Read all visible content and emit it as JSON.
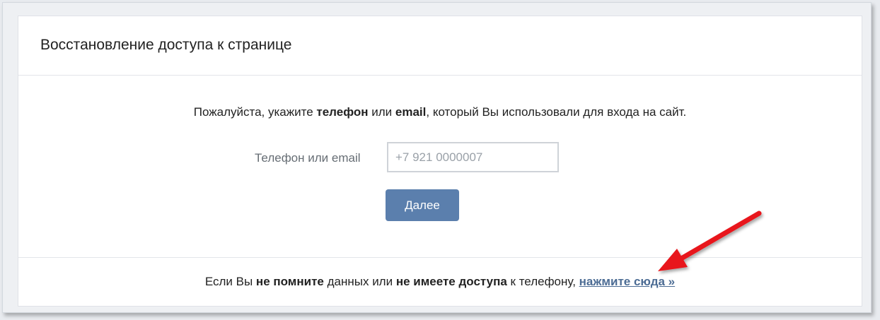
{
  "page": {
    "title": "Восстановление доступа к странице"
  },
  "form": {
    "instruction_part1": "Пожалуйста, укажите ",
    "instruction_bold1": "телефон",
    "instruction_part2": " или ",
    "instruction_bold2": "email",
    "instruction_part3": ", который Вы использовали для входа на сайт.",
    "field_label": "Телефон или email",
    "phone_placeholder": "+7 921 0000007",
    "next_button_label": "Далее"
  },
  "footer": {
    "part1": "Если Вы ",
    "bold1": "не помните",
    "part2": " данных или ",
    "bold2": "не имеете доступа",
    "part3": " к телефону, ",
    "link_label": "нажмите сюда »"
  },
  "annotation": {
    "arrow_color": "#e8141b"
  }
}
